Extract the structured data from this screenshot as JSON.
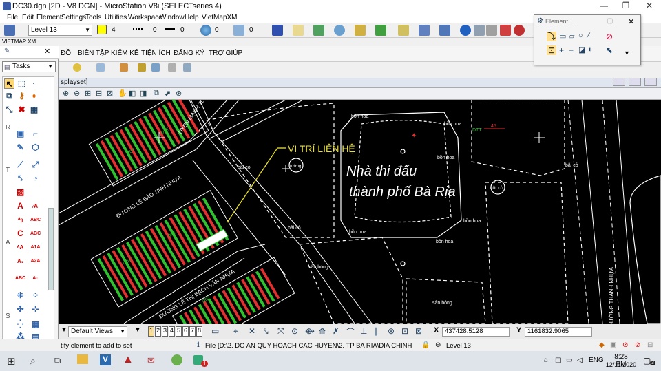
{
  "window": {
    "title": "DC30.dgn [2D - V8 DGN] - MicroStation V8i (SELECTseries 4)",
    "minimize": "—",
    "restore": "❐",
    "close": "✕"
  },
  "menu": [
    "File",
    "Edit",
    "Element",
    "Settings",
    "Tools",
    "Utilities",
    "Workspace",
    "Window",
    "Help",
    "VietMapXM"
  ],
  "attributes": {
    "level": "Level 13",
    "color_value": "4",
    "style_value": "0",
    "weight_value": "0",
    "transparency": "0",
    "priority": "0"
  },
  "vietmap": {
    "label": "VIETMAP XM",
    "menu": [
      "ĐỒ",
      "BIÊN TẬP",
      "KIỂM KÊ",
      "TIỆN ÍCH",
      "ĐĂNG KÝ",
      "TRỢ GIÚP"
    ]
  },
  "tasks": {
    "title": "Tasks",
    "selected": "Tasks",
    "side_letters": [
      "R",
      "T",
      "A",
      "S"
    ]
  },
  "element_dialog": {
    "title": "Element ..."
  },
  "view": {
    "title": "splayset]"
  },
  "bottom": {
    "views_combo": "Default Views",
    "view_numbers": [
      "1",
      "2",
      "3",
      "4",
      "5",
      "6",
      "7",
      "8"
    ]
  },
  "status": {
    "prompt": "tify element to add to set",
    "file_path": "File [D:\\2. DO AN QUY HOACH CAC HUYEN\\2. TP BA RIA\\DIA CHINH\\BAN DO DIA C",
    "level": "Level 13",
    "x_label": "X",
    "x_value": "437428.5128",
    "y_label": "Y",
    "y_value": "1161832.9065"
  },
  "taskbar": {
    "time": "8:28 PM",
    "date": "12/11/2020",
    "lang": "ENG",
    "notify_count": "3",
    "badge": "1"
  },
  "map": {
    "main_label_1": "Nhà thi đấu",
    "main_label_2": "thành phố Bà Rịa",
    "callout": "VỊ TRÍ LIÊN HỆ",
    "street_1": "ĐƯỜNG LÊ BẢO TỊNH NHỰA",
    "street_2": "UYEN MẠNH TƯỜNG NHỰA",
    "street_3": "ĐƯỜNG LÊ THỊ BẠCH VÂN NHỰA",
    "street_4": "ĐƯỜNG THÀNH NHỰA",
    "bonhoa": "bồn hoa",
    "baico": "bãi cỏ",
    "sanbong": "sân bóng",
    "cotco": "cột cờ",
    "dtt": "DTT",
    "dtt_num": "45",
    "tuong": "tường",
    "odt": "ODT",
    "colors": {
      "background": "#000000",
      "lines": "#ffffff",
      "lots_red": "#e03030",
      "lots_green": "#30c030",
      "callout": "#e8e030"
    }
  }
}
